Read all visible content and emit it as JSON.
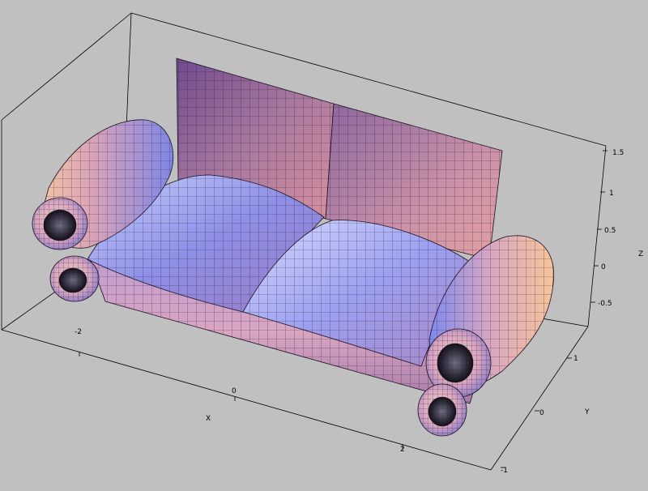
{
  "plot": {
    "background": "#c0c0c0",
    "wireframe_color": "#1a1020",
    "box_color": "#000000",
    "shading": {
      "light": "#dfe3ff",
      "blue": "#7f86e8",
      "purple": "#8a5a9c",
      "pink": "#dfa0b6",
      "peach": "#f2c4a3",
      "dark": "#2a2035"
    }
  },
  "axes": {
    "x": {
      "label": "X",
      "ticks": [
        "-2",
        "0",
        "2"
      ]
    },
    "y": {
      "label": "Y",
      "ticks": [
        "-1",
        "0",
        "1"
      ]
    },
    "z": {
      "label": "Z",
      "ticks": [
        "-0.5",
        "0",
        "0.5",
        "1",
        "1.5"
      ]
    }
  }
}
